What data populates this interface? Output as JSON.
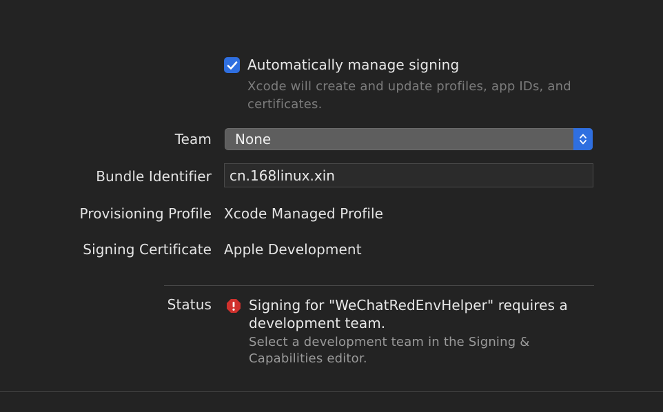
{
  "signing": {
    "auto_manage": {
      "checked": true,
      "label": "Automatically manage signing",
      "description": "Xcode will create and update profiles, app IDs, and certificates."
    },
    "team": {
      "label": "Team",
      "value": "None"
    },
    "bundle_identifier": {
      "label": "Bundle Identifier",
      "value": "cn.168linux.xin"
    },
    "provisioning_profile": {
      "label": "Provisioning Profile",
      "value": "Xcode Managed Profile"
    },
    "signing_certificate": {
      "label": "Signing Certificate",
      "value": "Apple Development"
    },
    "status": {
      "label": "Status",
      "icon": "error-icon",
      "message": "Signing for \"WeChatRedEnvHelper\" requires a development team.",
      "detail": "Select a development team in the Signing & Capabilities editor."
    }
  },
  "colors": {
    "background": "#232323",
    "accent": "#2f6fe0",
    "error": "#d0312d"
  }
}
